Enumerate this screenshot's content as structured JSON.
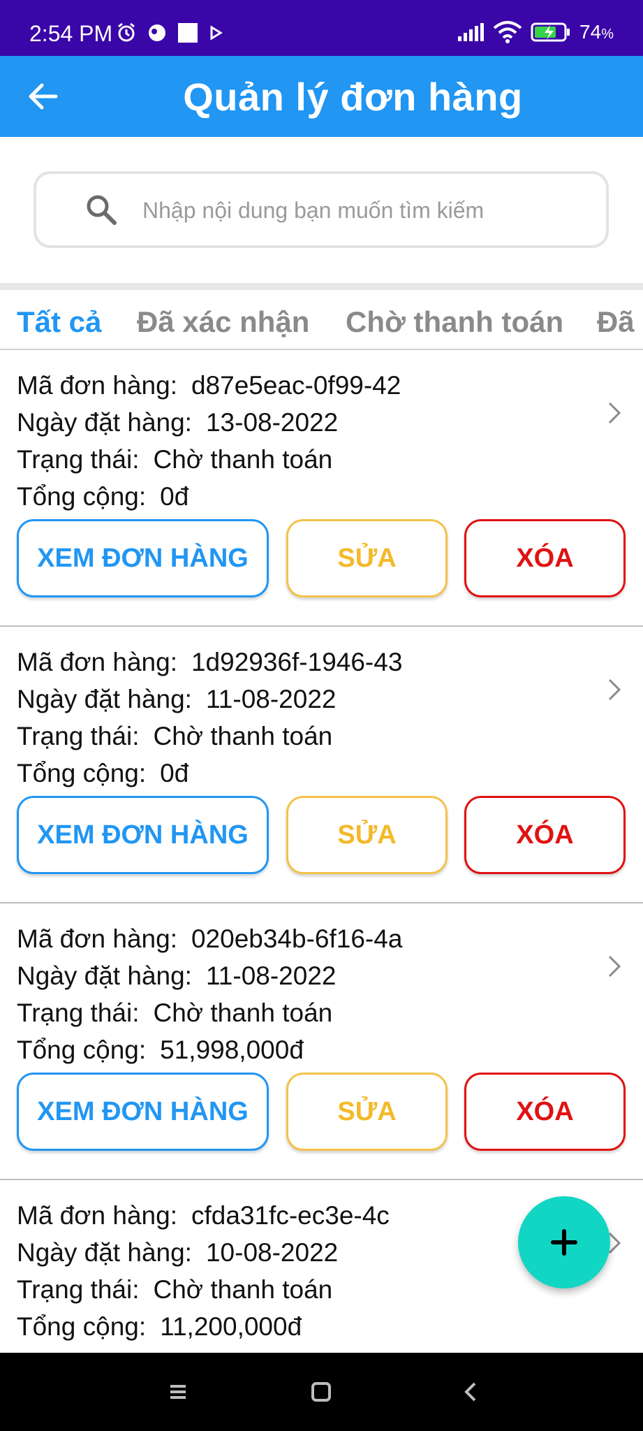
{
  "status_bar": {
    "time": "2:54 PM",
    "battery": "74",
    "battery_unit": "%"
  },
  "app_bar": {
    "title": "Quản lý đơn hàng"
  },
  "search": {
    "placeholder": "Nhập nội dung bạn muốn tìm kiếm"
  },
  "tabs": [
    {
      "label": "Tất cả",
      "active": true
    },
    {
      "label": "Đã xác nhận",
      "active": false
    },
    {
      "label": "Chờ thanh toán",
      "active": false
    },
    {
      "label": "Đã",
      "active": false
    }
  ],
  "labels": {
    "order_id": "Mã đơn hàng:",
    "order_date": "Ngày đặt hàng:",
    "status": "Trạng thái:",
    "total": "Tổng cộng:"
  },
  "buttons": {
    "view": "XEM ĐƠN HÀNG",
    "edit": "SỬA",
    "delete": "XÓA"
  },
  "orders": [
    {
      "id": "d87e5eac-0f99-42",
      "date": "13-08-2022",
      "status": "Chờ thanh toán",
      "total": "0đ"
    },
    {
      "id": "1d92936f-1946-43",
      "date": "11-08-2022",
      "status": "Chờ thanh toán",
      "total": "0đ"
    },
    {
      "id": "020eb34b-6f16-4a",
      "date": "11-08-2022",
      "status": "Chờ thanh toán",
      "total": "51,998,000đ"
    },
    {
      "id": "cfda31fc-ec3e-4c",
      "date": "10-08-2022",
      "status": "Chờ thanh toán",
      "total": "11,200,000đ"
    }
  ],
  "fab": {
    "icon": "plus-icon"
  },
  "colors": {
    "status_bar": "#3a06a8",
    "app_bar": "#2196f3",
    "view": "#2196f3",
    "edit": "#f4b92a",
    "delete": "#e01212",
    "fab": "#11d6c3"
  }
}
